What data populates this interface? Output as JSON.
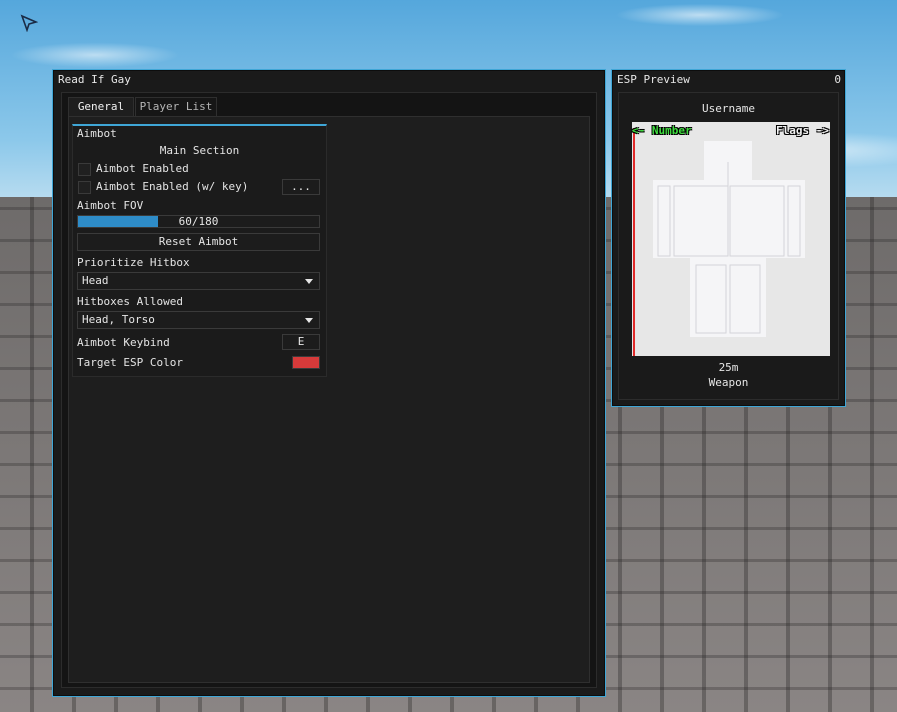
{
  "main_window": {
    "title": "Read If Gay",
    "tabs": [
      {
        "label": "General",
        "active": true
      },
      {
        "label": "Player List",
        "active": false
      }
    ],
    "section": {
      "title": "Aimbot",
      "subheader": "Main Section",
      "aimbot_enabled": {
        "label": "Aimbot Enabled",
        "checked": false
      },
      "aimbot_enabled_key": {
        "label": "Aimbot Enabled (w/ key)",
        "checked": false,
        "key_button": "..."
      },
      "fov": {
        "label": "Aimbot FOV",
        "text": "60/180",
        "value": 60,
        "max": 180
      },
      "reset_button": "Reset Aimbot",
      "prioritize_hitbox": {
        "label": "Prioritize Hitbox",
        "value": "Head"
      },
      "hitboxes_allowed": {
        "label": "Hitboxes Allowed",
        "value": "Head, Torso"
      },
      "keybind": {
        "label": "Aimbot Keybind",
        "value": "E"
      },
      "target_color": {
        "label": "Target ESP Color",
        "color": "#d63a3a"
      }
    }
  },
  "esp_preview": {
    "title": "ESP Preview",
    "count": "0",
    "username": "Username",
    "number_label": "<- Number",
    "flags_label": "Flags ->",
    "distance": "25m",
    "weapon": "Weapon"
  },
  "colors": {
    "accent": "#3fa6d6",
    "window_bg": "#1a1a1a",
    "slider_fill": "#2e8cc8",
    "number_text": "#3fdc3f",
    "health_bar": "#e12a2a"
  },
  "icons": {
    "cursor": "cursor-arrow-icon",
    "dropdown": "chevron-down-icon"
  }
}
